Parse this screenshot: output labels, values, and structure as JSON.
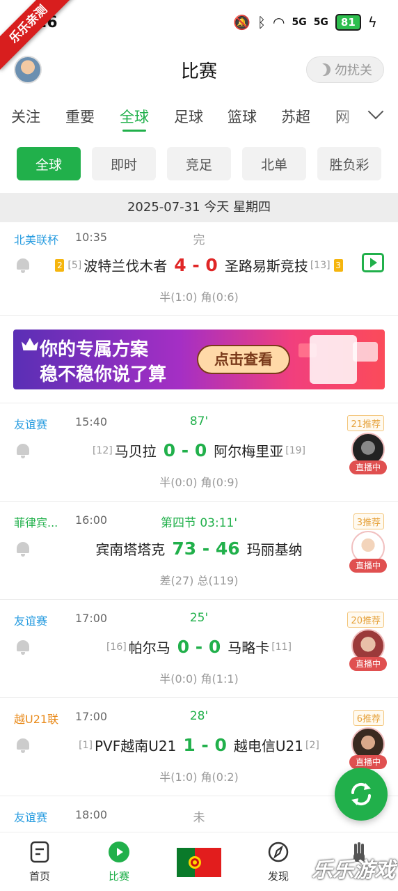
{
  "status_bar": {
    "time": "26",
    "battery": "81",
    "signal1": "5G",
    "signal2": "5G"
  },
  "ribbon": "乐乐亲测",
  "header": {
    "title": "比赛",
    "dnd_label": "勿扰关"
  },
  "tabs": [
    "关注",
    "重要",
    "全球",
    "足球",
    "篮球",
    "苏超",
    "网"
  ],
  "active_tab": "全球",
  "chips": [
    "全球",
    "即时",
    "竞足",
    "北单",
    "胜负彩"
  ],
  "date_bar": "2025-07-31 今天 星期四",
  "matches": [
    {
      "league": "北美联杯",
      "league_color": "#2a9de0",
      "time": "10:35",
      "status": "完",
      "status_color": "#999999",
      "home_card": "2",
      "home_rank": "[5]",
      "home": "波特兰伐木者",
      "score": "4 - 0",
      "score_color": "red",
      "away": "圣路易斯竞技",
      "away_rank": "[13]",
      "away_card": "3",
      "stats": "半(1:0) 角(0:6)"
    },
    {
      "league": "友谊赛",
      "league_color": "#2a9de0",
      "time": "15:40",
      "status": "87'",
      "status_color": "#21b04b",
      "home_rank": "[12]",
      "home": "马贝拉",
      "score": "0 - 0",
      "score_color": "green",
      "away": "阿尔梅里亚",
      "away_rank": "[19]",
      "stats": "半(0:0) 角(0:9)",
      "recommend": "21推荐",
      "live": "直播中"
    },
    {
      "league": "菲律宾...",
      "league_color": "#21b04b",
      "time": "16:00",
      "status": "第四节 03:11'",
      "status_color": "#21b04b",
      "home": "宾南塔塔克",
      "score": "73 - 46",
      "score_color": "green",
      "away": "玛丽基纳",
      "stats": "差(27) 总(119)",
      "recommend": "3推荐",
      "live": "直播中"
    },
    {
      "league": "友谊赛",
      "league_color": "#2a9de0",
      "time": "17:00",
      "status": "25'",
      "status_color": "#21b04b",
      "home_rank": "[16]",
      "home": "帕尔马",
      "score": "0 - 0",
      "score_color": "green",
      "away": "马略卡",
      "away_rank": "[11]",
      "stats": "半(0:0) 角(1:1)",
      "recommend": "20推荐",
      "live": "直播中"
    },
    {
      "league": "越U21联",
      "league_color": "#e98a1a",
      "time": "17:00",
      "status": "28'",
      "status_color": "#21b04b",
      "home_rank": "[1]",
      "home": "PVF越南U21",
      "score": "1 - 0",
      "score_color": "green",
      "away": "越电信U21",
      "away_rank": "[2]",
      "stats": "半(1:0) 角(0:2)",
      "recommend": "6推荐",
      "live": "直播中"
    },
    {
      "league": "友谊赛",
      "league_color": "#2a9de0",
      "time": "18:00",
      "status": "未",
      "status_color": "#999999"
    }
  ],
  "banner": {
    "line1": "你的专属方案",
    "line2": "稳不稳你说了算",
    "cta": "点击查看"
  },
  "bottom_nav": [
    {
      "label": "首页",
      "icon": "home-doc-icon"
    },
    {
      "label": "比赛",
      "icon": "play-circle-icon"
    },
    {
      "label": "",
      "icon": "portugal-flag"
    },
    {
      "label": "发现",
      "icon": "compass-icon"
    },
    {
      "label": "",
      "icon": "hand-icon"
    }
  ],
  "watermark": "乐乐游戏"
}
